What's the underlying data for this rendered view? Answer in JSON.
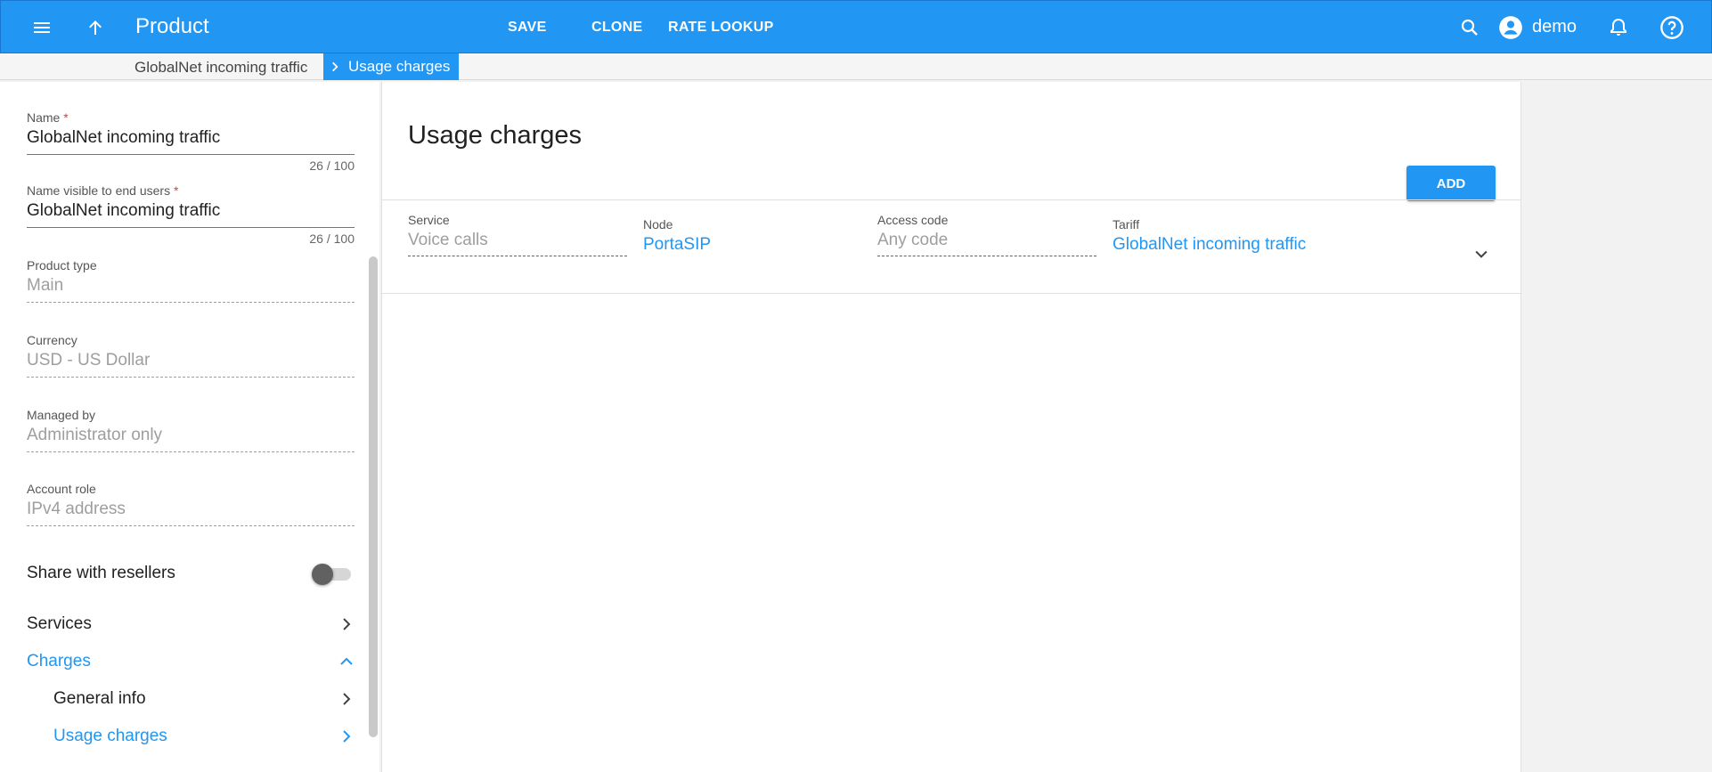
{
  "header": {
    "title": "Product",
    "actions": [
      "SAVE",
      "CLONE",
      "RATE LOOKUP"
    ],
    "user": "demo"
  },
  "breadcrumb": {
    "parent": "GlobalNet incoming traffic",
    "current": "Usage charges"
  },
  "sidebar": {
    "name": {
      "label": "Name",
      "value": "GlobalNet incoming traffic",
      "counter": "26 / 100"
    },
    "name_visible": {
      "label": "Name visible to end users",
      "value": "GlobalNet incoming traffic",
      "counter": "26 / 100"
    },
    "product_type": {
      "label": "Product type",
      "value": "Main"
    },
    "currency": {
      "label": "Currency",
      "value": "USD - US Dollar"
    },
    "managed_by": {
      "label": "Managed by",
      "value": "Administrator only"
    },
    "account_role": {
      "label": "Account role",
      "value": "IPv4 address"
    },
    "share_label": "Share with resellers",
    "share_enabled": false,
    "nav": {
      "services": "Services",
      "charges": "Charges",
      "general_info": "General info",
      "usage_charges": "Usage charges"
    }
  },
  "main": {
    "title": "Usage charges",
    "add_label": "ADD",
    "row": {
      "service": {
        "label": "Service",
        "value": "Voice calls"
      },
      "node": {
        "label": "Node",
        "value": "PortaSIP"
      },
      "access_code": {
        "label": "Access code",
        "value": "Any code"
      },
      "tariff": {
        "label": "Tariff",
        "value": "GlobalNet incoming traffic"
      }
    }
  },
  "colors": {
    "accent": "#2196f3",
    "required": "#e53935"
  },
  "icons": [
    "menu-icon",
    "arrow-up-icon",
    "search-icon",
    "account-circle-icon",
    "bell-icon",
    "help-icon",
    "chevron-right-icon",
    "chevron-up-icon",
    "chevron-down-icon"
  ]
}
